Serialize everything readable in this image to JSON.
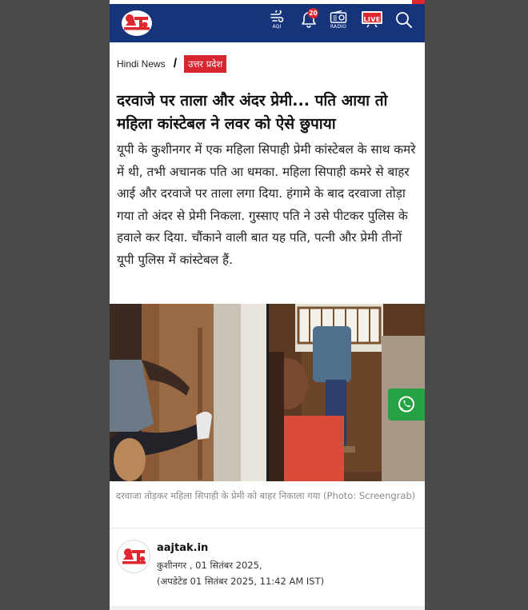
{
  "header": {
    "logo_text": "आज तक",
    "aqi_label": "AQI",
    "notification_count": "20",
    "radio_label": "RADIO",
    "live_label": "LIVE"
  },
  "breadcrumb": {
    "home": "Hindi News",
    "separator": "/",
    "category": "उत्तर प्रदेश"
  },
  "article": {
    "headline": "दरवाजे पर ताला और अंदर प्रेमी... पति आया तो महिला कांस्टेबल ने लवर को ऐसे छुपाया",
    "summary": "यूपी के कुशीनगर में एक महिला सिपाही प्रेमी कांस्टेबल के साथ कमरे में थी, तभी अचानक पति आ धमका. महिला सिपाही कमरे से बाहर आई और दरवाजे पर ताला लगा दिया. हंगामे के बाद  दरवाजा तोड़ा गया तो अंदर से प्रेमी निकला. गुस्साए पति ने उसे पीटकर पुलिस के हवाले कर दिया. चौंकाने वाली बात यह पति, पत्नी और प्रेमी तीनों यूपी पुलिस में कांस्टेबल हैं.",
    "image_caption": "दरवाजा तोड़कर महिला सिपाही के प्रेमी को बाहर निकाला गया (Photo: Screengrab)"
  },
  "author": {
    "name": "aajtak.in",
    "location_date": "कुशीनगर , 01 सितंबर 2025,",
    "updated": "(अपडेटेड 01 सितंबर 2025, 11:42 AM IST)"
  },
  "colors": {
    "header_bg": "#16347a",
    "brand_red": "#e0262f",
    "whatsapp_green": "#25a244"
  }
}
